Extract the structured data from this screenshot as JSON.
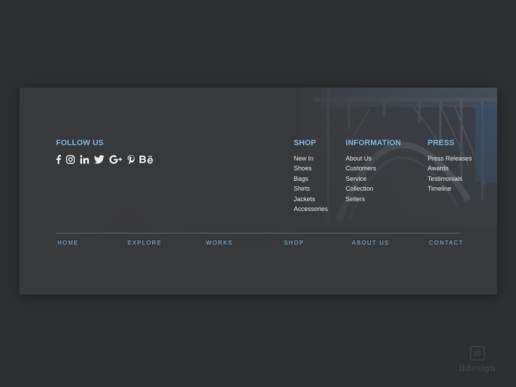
{
  "colors": {
    "page_bg": "#2e2f31",
    "card_bg": "#38393b",
    "accent": "#7ab8e0",
    "text": "#e6e6e6",
    "divider": "#4a6c78"
  },
  "follow": {
    "title": "FOLLOW US",
    "icons": [
      "facebook-icon",
      "instagram-icon",
      "linkedin-icon",
      "twitter-icon",
      "google-plus-icon",
      "pinterest-icon",
      "behance-icon"
    ]
  },
  "shop": {
    "title": "SHOP",
    "items": [
      "New In",
      "Shoes",
      "Bags",
      "Shirts",
      "Jackets",
      "Accessories"
    ]
  },
  "information": {
    "title": "INFORMATION",
    "items": [
      "About Us",
      "Customers",
      "Service",
      "Collection",
      "Sellers"
    ]
  },
  "press": {
    "title": "PRESS",
    "items": [
      "Press Releases",
      "Awards",
      "Testimonials",
      "Timeline"
    ]
  },
  "nav": {
    "items": [
      "HOME",
      "EXPLORE",
      "WORKS",
      "SHOP",
      "ABOUT US",
      "CONTACT"
    ]
  },
  "watermark": {
    "mark": "iii",
    "text": "ildesign"
  }
}
